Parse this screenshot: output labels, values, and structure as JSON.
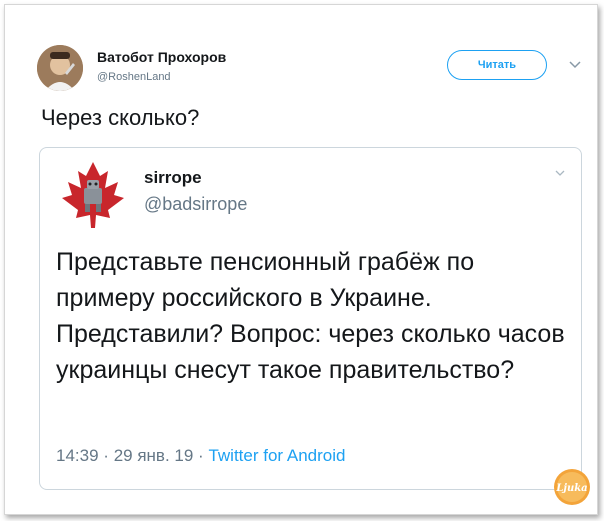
{
  "tweet": {
    "author_name": "Ватобот Прохоров",
    "author_handle": "@RoshenLand",
    "follow_label": "Читать",
    "text": "Через сколько?"
  },
  "quoted": {
    "author_name": "sirrope",
    "author_handle": "@badsirrope",
    "text": "Представьте пенсионный грабёж по примеру российского в Украине. Представили? Вопрос: через сколько часов украинцы снесут такое правительство?",
    "time": "14:39",
    "date": "29 янв. 19",
    "separator": "·",
    "source": "Twitter for Android"
  },
  "watermark_text": "Ljuka",
  "colors": {
    "accent": "#1da1f2",
    "text": "#14171a",
    "muted": "#657786",
    "border": "#ccd6dd"
  },
  "icons": {
    "menu": "chevron-down-icon",
    "avatar_quoted": "maple-leaf-robot-icon"
  }
}
